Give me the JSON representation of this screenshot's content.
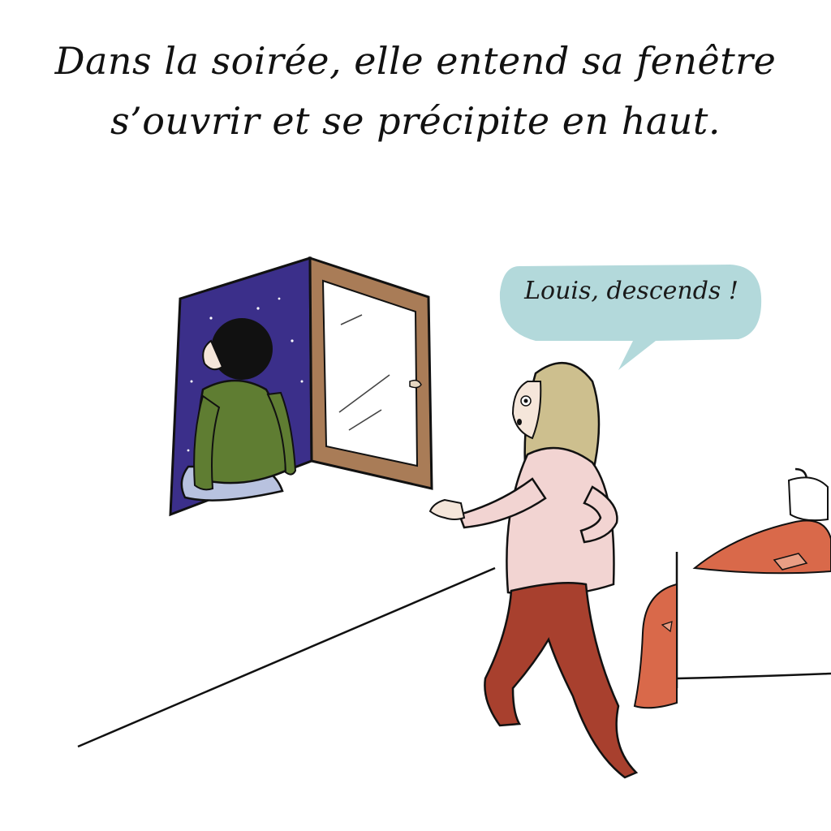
{
  "caption": {
    "line1": "Dans la soirée, elle entend sa fenêtre",
    "line2": "s’ouvrir et se précipite en haut."
  },
  "speech_bubble": {
    "text": "Louis, descends !"
  },
  "colors": {
    "night_sky": "#3b2f8a",
    "window_frame": "#a97c57",
    "bubble_fill": "#b3d9db",
    "sweater": "#5f7d32",
    "woman_top": "#f2d4d2",
    "woman_pants": "#a8402e",
    "hair_blonde": "#cdbf8e",
    "blanket": "#d9694a"
  },
  "icons": [
    "window-with-night-sky",
    "boy-character",
    "woman-character",
    "bed-icon",
    "speech-bubble"
  ]
}
